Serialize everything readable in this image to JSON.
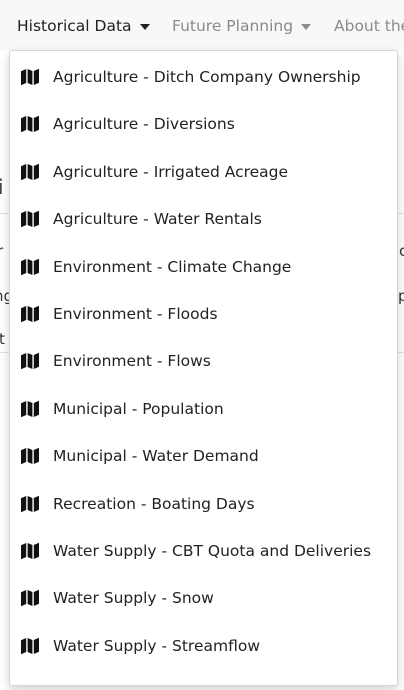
{
  "navbar": {
    "items": [
      {
        "label": "Historical Data",
        "active": true
      },
      {
        "label": "Future Planning",
        "active": false
      },
      {
        "label": "About the"
      }
    ]
  },
  "background": {
    "heading_fragment": "i",
    "left_fragments": [
      "r",
      "ng",
      "t"
    ],
    "right_fragments": [
      "c",
      "p"
    ]
  },
  "dropdown": {
    "icon": "map-icon",
    "items": [
      {
        "label": "Agriculture - Ditch Company Ownership"
      },
      {
        "label": "Agriculture - Diversions"
      },
      {
        "label": "Agriculture - Irrigated Acreage"
      },
      {
        "label": "Agriculture - Water Rentals"
      },
      {
        "label": "Environment - Climate Change"
      },
      {
        "label": "Environment - Floods"
      },
      {
        "label": "Environment - Flows"
      },
      {
        "label": "Municipal - Population"
      },
      {
        "label": "Municipal - Water Demand"
      },
      {
        "label": "Recreation - Boating Days"
      },
      {
        "label": "Water Supply - CBT Quota and Deliveries"
      },
      {
        "label": "Water Supply - Snow"
      },
      {
        "label": "Water Supply - Streamflow"
      }
    ]
  },
  "colors": {
    "navbar_bg": "#f8f8f8",
    "nav_active": "#222222",
    "nav_inactive": "#8a8a8a",
    "menu_text": "#222222"
  }
}
